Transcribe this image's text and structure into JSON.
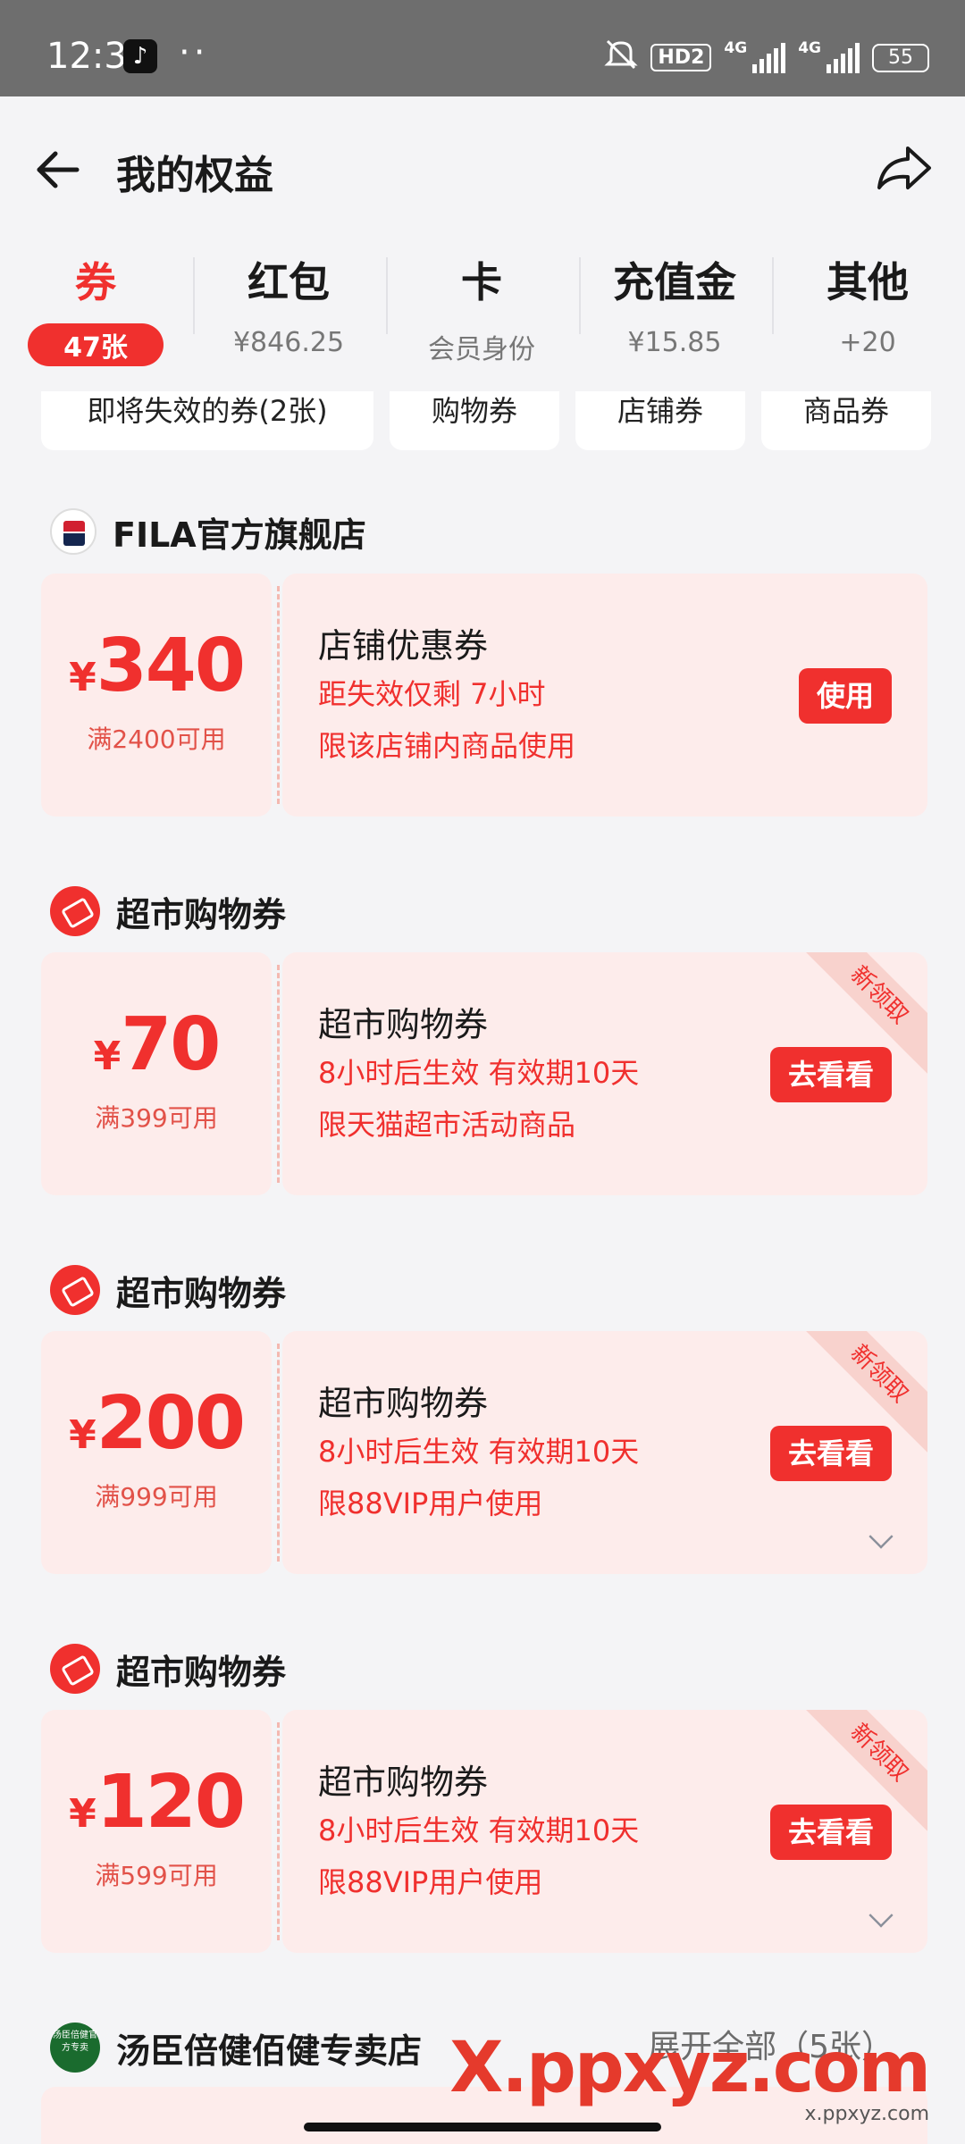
{
  "status_bar": {
    "time": "12:31",
    "dots": "··",
    "hd": "HD2",
    "net": "4G",
    "battery": "55"
  },
  "header": {
    "title": "我的权益"
  },
  "tabs": [
    {
      "label": "券",
      "sub": "47张"
    },
    {
      "label": "红包",
      "sub": "¥846.25"
    },
    {
      "label": "卡",
      "sub": "会员身份"
    },
    {
      "label": "充值金",
      "sub": "¥15.85"
    },
    {
      "label": "其他",
      "sub": "+20"
    }
  ],
  "filters": [
    "即将失效的券(2张)",
    "购物券",
    "店铺券",
    "商品券"
  ],
  "sections": [
    {
      "store": "FILA官方旗舰店",
      "currency": "¥",
      "amount": "340",
      "condition": "满2400可用",
      "title": "店铺优惠券",
      "line1": "距失效仅剩 7小时",
      "line2": "限该店铺内商品使用",
      "button": "使用"
    },
    {
      "store": "超市购物券",
      "currency": "¥",
      "amount": "70",
      "condition": "满399可用",
      "title": "超市购物券",
      "line1": "8小时后生效 有效期10天",
      "line2": "限天猫超市活动商品",
      "button": "去看看",
      "ribbon": "新领取"
    },
    {
      "store": "超市购物券",
      "currency": "¥",
      "amount": "200",
      "condition": "满999可用",
      "title": "超市购物券",
      "line1": "8小时后生效 有效期10天",
      "line2": "限88VIP用户使用",
      "button": "去看看",
      "ribbon": "新领取"
    },
    {
      "store": "超市购物券",
      "currency": "¥",
      "amount": "120",
      "condition": "满599可用",
      "title": "超市购物券",
      "line1": "8小时后生效 有效期10天",
      "line2": "限88VIP用户使用",
      "button": "去看看",
      "ribbon": "新领取"
    }
  ],
  "next_store": {
    "name": "汤臣倍健佰健专卖店",
    "logo_text": "汤臣倍健官方专卖",
    "expand": "展开全部（5张）"
  },
  "watermark": {
    "main": "X.ppxyz.com",
    "sub": "x.ppxyz.com"
  },
  "colors": {
    "accent": "#f0302e",
    "coupon_bg": "#fdeceb",
    "status_bar": "#6e6e6e"
  }
}
